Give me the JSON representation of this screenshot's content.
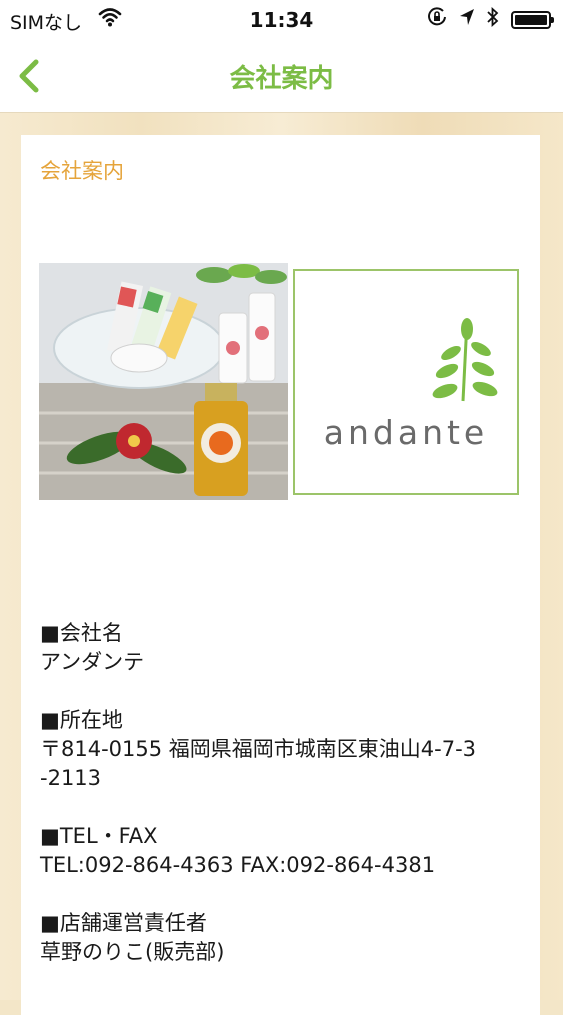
{
  "status_bar": {
    "carrier": "SIMなし",
    "time": "11:34"
  },
  "nav": {
    "title": "会社案内"
  },
  "card": {
    "title": "会社案内",
    "logo_text": "andante"
  },
  "info": [
    {
      "heading": "■会社名",
      "lines": [
        "アンダンテ"
      ]
    },
    {
      "heading": "■所在地",
      "lines": [
        "〒814-0155 福岡県福岡市城南区東油山4-7-3",
        "-2113"
      ]
    },
    {
      "heading": "■TEL・FAX",
      "lines": [
        "TEL:092-864-4363 FAX:092-864-4381"
      ]
    },
    {
      "heading": "■店舗運営責任者",
      "lines": [
        "草野のりこ(販売部)"
      ]
    }
  ],
  "colors": {
    "accent_green": "#7cbc45",
    "card_title_orange": "#e5a43b",
    "logo_border": "#9cc469"
  }
}
